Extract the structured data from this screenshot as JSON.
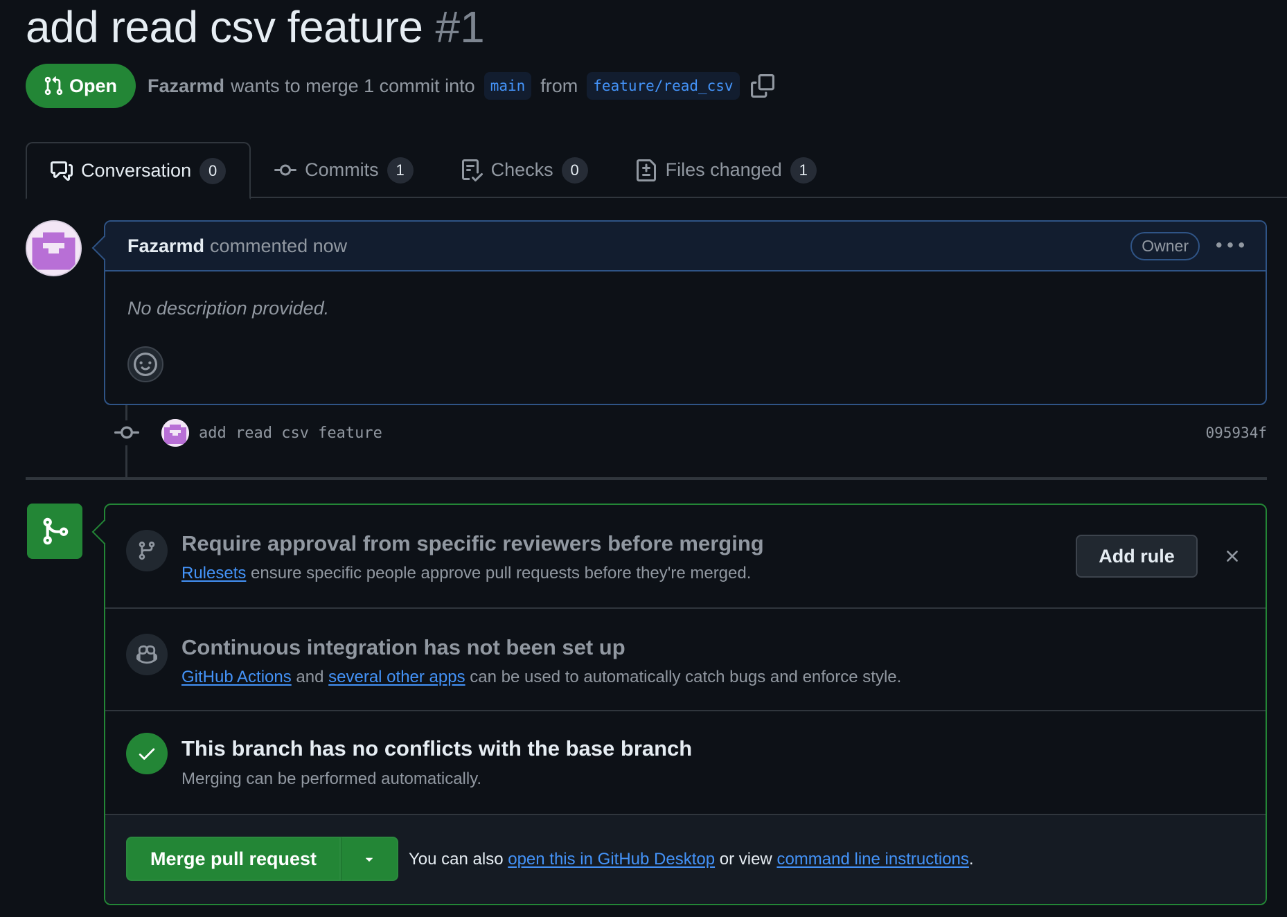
{
  "pr": {
    "title": "add read csv feature",
    "number": "#1",
    "state": "Open",
    "author": "Fazarmd",
    "merge_text": "wants to merge 1 commit into",
    "base_branch": "main",
    "from_text": "from",
    "head_branch": "feature/read_csv"
  },
  "tabs": [
    {
      "label": "Conversation",
      "count": "0",
      "icon": "comment-discussion-icon"
    },
    {
      "label": "Commits",
      "count": "1",
      "icon": "git-commit-icon"
    },
    {
      "label": "Checks",
      "count": "0",
      "icon": "checklist-icon"
    },
    {
      "label": "Files changed",
      "count": "1",
      "icon": "file-diff-icon"
    }
  ],
  "comment": {
    "author": "Fazarmd",
    "time": "commented now",
    "badge": "Owner",
    "body": "No description provided."
  },
  "commit": {
    "message": "add read csv feature",
    "sha": "095934f"
  },
  "merge_box": {
    "rule": {
      "heading": "Require approval from specific reviewers before merging",
      "link": "Rulesets",
      "text": "ensure specific people approve pull requests before they're merged.",
      "button": "Add rule"
    },
    "ci": {
      "heading": "Continuous integration has not been set up",
      "link1": "GitHub Actions",
      "and": "and",
      "link2": "several other apps",
      "text": "can be used to automatically catch bugs and enforce style."
    },
    "conflicts": {
      "heading": "This branch has no conflicts with the base branch",
      "text": "Merging can be performed automatically."
    },
    "merge": {
      "button": "Merge pull request",
      "hint_pre": "You can also",
      "link1": "open this in GitHub Desktop",
      "hint_mid": "or view",
      "link2": "command line instructions",
      "hint_end": "."
    }
  },
  "colors": {
    "background": "#0d1117",
    "success": "#238636",
    "accent": "#4493f8",
    "muted": "#9198a1"
  }
}
